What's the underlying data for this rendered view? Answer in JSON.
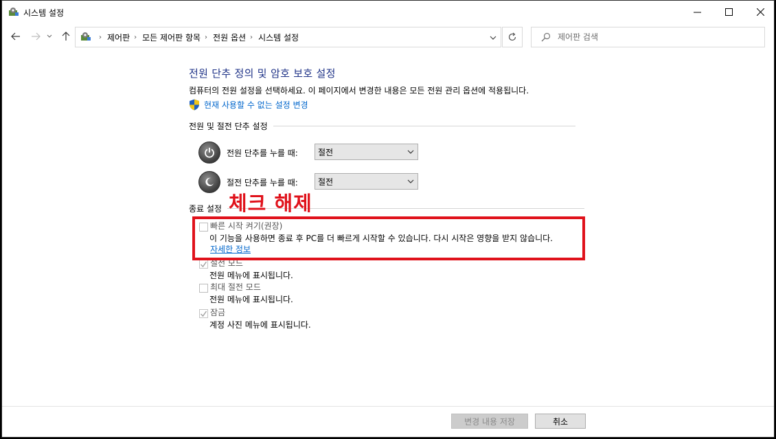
{
  "window": {
    "title": "시스템 설정"
  },
  "navigation": {
    "breadcrumbs": [
      "제어판",
      "모든 제어판 항목",
      "전원 옵션",
      "시스템 설정"
    ],
    "search_placeholder": "제어판 검색"
  },
  "main": {
    "heading": "전원 단추 정의 및 암호 보호 설정",
    "description": "컴퓨터의 전원 설정을 선택하세요. 이 페이지에서 변경한 내용은 모든 전원 관리 옵션에 적용됩니다.",
    "change_settings_link": "현재 사용할 수 없는 설정 변경",
    "power_section_title": "전원 및 절전 단추 설정",
    "power_button": {
      "label": "전원 단추를 누를 때:",
      "value": "절전"
    },
    "sleep_button": {
      "label": "절전 단추를 누를 때:",
      "value": "절전"
    },
    "shutdown_section_title": "종료 설정",
    "options": [
      {
        "title": "빠른 시작 켜기(권장)",
        "description": "이 기능을 사용하면 종료 후 PC를 더 빠르게 시작할 수 있습니다. 다시 시작은 영향을 받지 않습니다.",
        "link": "자세한 정보",
        "checked": false
      },
      {
        "title": "절전 모드",
        "description": "전원 메뉴에 표시됩니다.",
        "checked": true
      },
      {
        "title": "최대 절전 모드",
        "description": "전원 메뉴에 표시됩니다.",
        "checked": false
      },
      {
        "title": "잠금",
        "description": "계정 사진 메뉴에 표시됩니다.",
        "checked": true
      }
    ]
  },
  "annotation": {
    "text": "체크 해제",
    "color": "#e0121b"
  },
  "footer": {
    "save_label": "변경 내용 저장",
    "cancel_label": "취소"
  }
}
